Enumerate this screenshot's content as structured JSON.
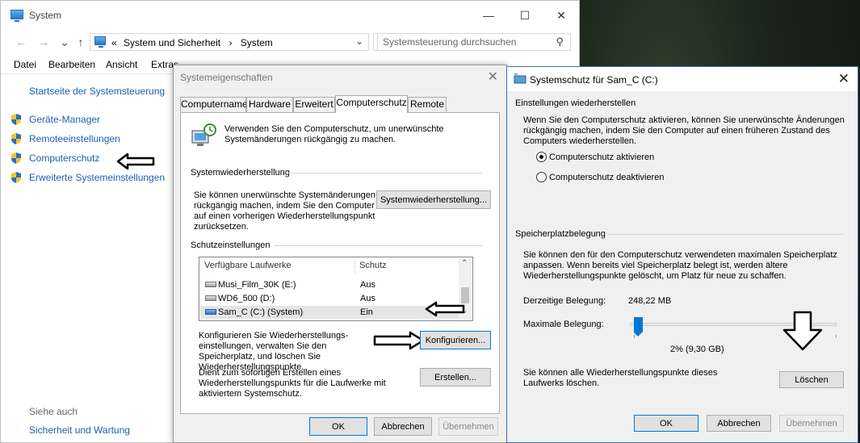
{
  "system_window": {
    "title": "System",
    "nav": {
      "back": "←",
      "forward": "→",
      "up": "↑"
    },
    "address": {
      "chevrons": "«",
      "crumb1": "System und Sicherheit",
      "sep": "›",
      "crumb2": "System"
    },
    "search_placeholder": "Systemsteuerung durchsuchen",
    "menu": [
      "Datei",
      "Bearbeiten",
      "Ansicht",
      "Extras"
    ],
    "sidebar": {
      "home": "Startseite der Systemsteuerung",
      "links": [
        "Geräte-Manager",
        "Remoteeinstellungen",
        "Computerschutz",
        "Erweiterte Systemeinstellungen"
      ],
      "see_also": "Siehe auch",
      "see_also_links": [
        "Sicherheit und Wartung"
      ]
    }
  },
  "props_dialog": {
    "title": "Systemeigenschaften",
    "tabs": [
      "Computername",
      "Hardware",
      "Erweitert",
      "Computerschutz",
      "Remote"
    ],
    "active_tab": "Computerschutz",
    "intro": "Verwenden Sie den Computerschutz, um unerwünschte Systemänderungen rückgängig zu machen.",
    "restore_group": "Systemwiederherstellung",
    "restore_text": "Sie können unerwünschte Systemänderungen rückgängig machen, indem Sie den Computer auf einen vorherigen Wiederherstellungspunkt zurücksetzen.",
    "restore_button": "Systemwiederherstellung...",
    "protection_group": "Schutzeinstellungen",
    "drives_header": {
      "drive": "Verfügbare Laufwerke",
      "protection": "Schutz"
    },
    "drives": [
      {
        "name": "Musi_Film_30K (E:)",
        "status": "Aus"
      },
      {
        "name": "WD6_500 (D:)",
        "status": "Aus"
      },
      {
        "name": "Sam_C (C:) (System)",
        "status": "Ein"
      }
    ],
    "configure_text": "Konfigurieren Sie Wiederherstellungs-einstellungen, verwalten Sie den Speicherplatz, und löschen Sie Wiederherstellungspunkte.",
    "configure_button": "Konfigurieren...",
    "create_text": "Dient zum sofortigen Erstellen eines Wiederherstellungspunkts für die Laufwerke mit aktiviertem Systemschutz.",
    "create_button": "Erstellen...",
    "ok": "OK",
    "cancel": "Abbrechen",
    "apply": "Übernehmen"
  },
  "ss_dialog": {
    "title": "Systemschutz für Sam_C (C:)",
    "restore_settings": "Einstellungen wiederherstellen",
    "restore_desc": "Wenn Sie den Computerschutz aktivieren, können Sie unerwünschte Änderungen rückgängig machen, indem Sie den Computer auf einen früheren Zustand des Computers wiederherstellen.",
    "radio_on": "Computerschutz aktivieren",
    "radio_off": "Computerschutz deaktivieren",
    "radio_selected": "Computerschutz aktivieren",
    "disk_usage": "Speicherplatzbelegung",
    "disk_desc": "Sie können den für den Computerschutz verwendeten maximalen Speicherplatz anpassen. Wenn bereits viel Speicherplatz belegt ist, werden ältere Wiederherstellungspunkte gelöscht, um Platz für neue zu schaffen.",
    "current_label": "Derzeitige Belegung:",
    "current_value": "248,22 MB",
    "max_label": "Maximale Belegung:",
    "slider_percent": 2,
    "slider_readout": "2% (9,30 GB)",
    "delete_text": "Sie können alle Wiederherstellungspunkte dieses Laufwerks löschen.",
    "delete_button": "Löschen",
    "ok": "OK",
    "cancel": "Abbrechen",
    "apply": "Übernehmen"
  },
  "colors": {
    "link": "#1a5fb4",
    "accent": "#0078d7"
  }
}
